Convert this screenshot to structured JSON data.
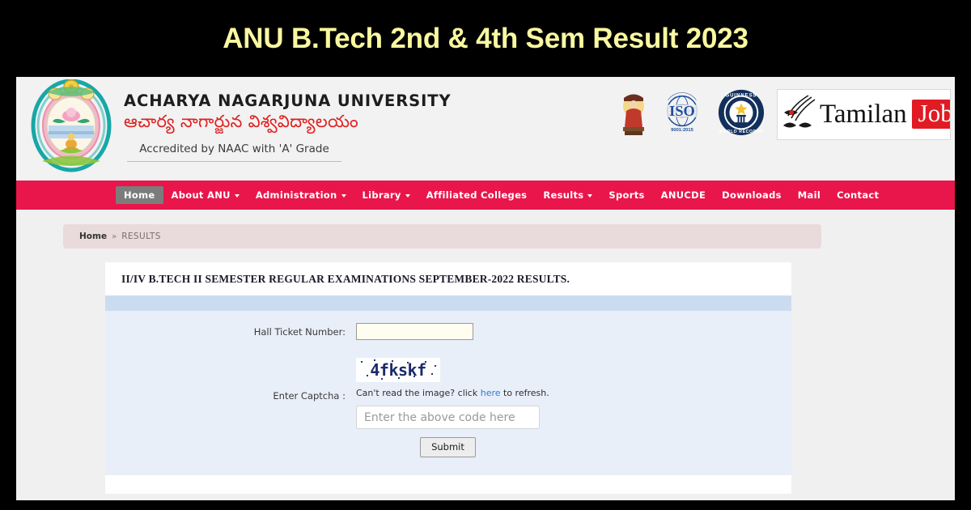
{
  "banner": {
    "title": "ANU B.Tech 2nd & 4th Sem Result 2023",
    "text_color": "#FAF8A0",
    "background_color": "#000000"
  },
  "site_header": {
    "emblem_alt": "acharya-nagarjuna-university-emblem",
    "university_name_english": "ACHARYA NAGARJUNA UNIVERSITY",
    "university_name_telugu": "ఆచార్య నాగార్జున విశ్వవిద్యాలయం",
    "accreditation": "Accredited by NAAC with  'A'  Grade",
    "badges": [
      {
        "name": "buddha-statue-icon",
        "label": ""
      },
      {
        "name": "iso-certification-badge",
        "label": "ISO",
        "sublabel": "9001:2015"
      },
      {
        "name": "guinness-world-records-badge",
        "top_label": "GUINNESS",
        "bottom_label": "WORLD RECORDS"
      },
      {
        "name": "tamilan-jobs-watermark",
        "word": "Tamilan",
        "highlight": "Jobs"
      }
    ]
  },
  "navbar": {
    "background_color": "#E8164B",
    "active_color": "#7C7C7C",
    "items": [
      {
        "label": "Home",
        "active": true,
        "dropdown": false
      },
      {
        "label": "About ANU",
        "active": false,
        "dropdown": true
      },
      {
        "label": "Administration",
        "active": false,
        "dropdown": true
      },
      {
        "label": "Library",
        "active": false,
        "dropdown": true
      },
      {
        "label": "Affiliated Colleges",
        "active": false,
        "dropdown": false
      },
      {
        "label": "Results",
        "active": false,
        "dropdown": true
      },
      {
        "label": "Sports",
        "active": false,
        "dropdown": false
      },
      {
        "label": "ANUCDE",
        "active": false,
        "dropdown": false
      },
      {
        "label": "Downloads",
        "active": false,
        "dropdown": false
      },
      {
        "label": "Mail",
        "active": false,
        "dropdown": false
      },
      {
        "label": "Contact",
        "active": false,
        "dropdown": false
      }
    ]
  },
  "breadcrumb": {
    "home": "Home",
    "separator": "»",
    "current": "RESULTS"
  },
  "result_panel": {
    "heading": "II/IV B.TECH II SEMESTER REGULAR EXAMINATIONS SEPTEMBER-2022 RESULTS.",
    "hall_ticket": {
      "label": "Hall Ticket Number:",
      "value": "",
      "placeholder": ""
    },
    "captcha": {
      "label": "Enter Captcha :",
      "image_text": "4fkskf",
      "hint_before": "Can't read the image? click ",
      "hint_link": "here",
      "hint_after": " to refresh.",
      "input_value": "",
      "input_placeholder": "Enter the above code here"
    },
    "submit_label": "Submit"
  }
}
